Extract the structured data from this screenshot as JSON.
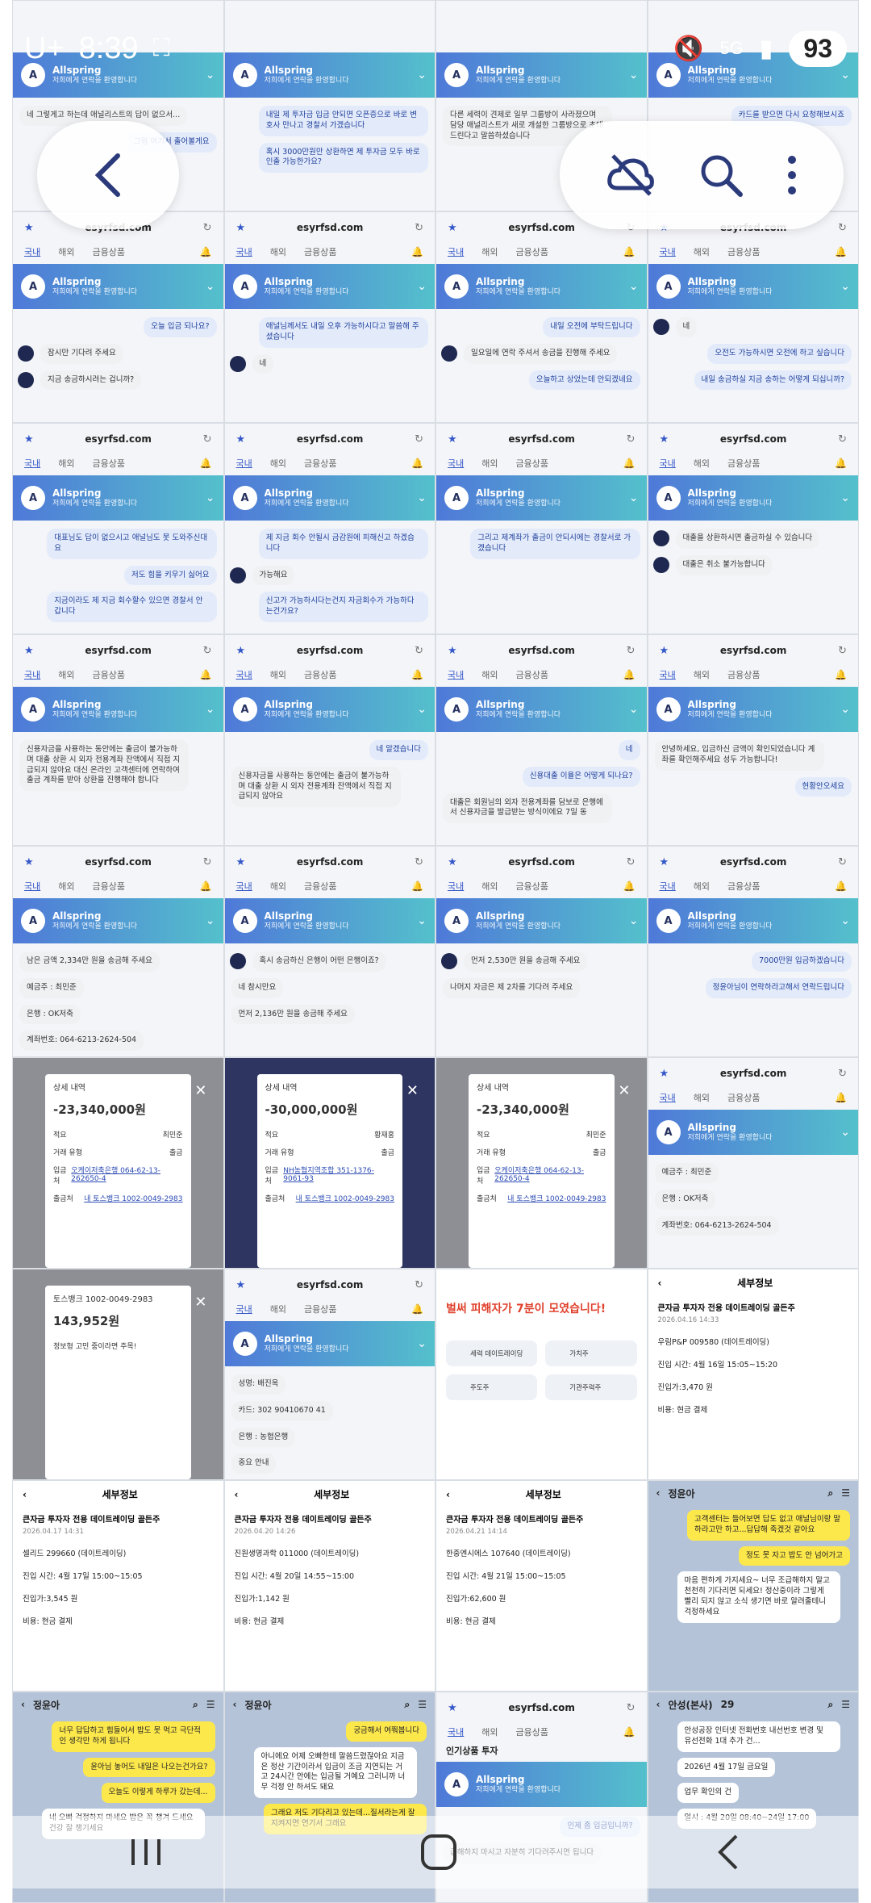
{
  "status_bar": {
    "time": "8:39",
    "network": "5G",
    "battery": "93",
    "carrier": "U+"
  },
  "site": {
    "url": "esyrfsd.com",
    "tabs": [
      "국내",
      "해외",
      "금융상품"
    ]
  },
  "banner": {
    "name": "Allspring",
    "subtitle": "저희에게 연락을 환영합니다"
  },
  "tiles": {
    "t1": [
      "네 그렇게고 하는데 애널리스트의 답이 없으서...",
      "그럼 여기서 출어볼게요"
    ],
    "t2": [
      "내일 제 투자금 입금 안되면 오픈증으로 바로 변호사 만나고 경찰서 가겠습니다",
      "혹시 3000만원만 상환하면 제 투자금 모두 바로 인출 가능한가요?"
    ],
    "t3": [
      "다른 세력이 견제로 일부 그룹방이 사라졌으며 담당 애널리스트가 새로 개설한 그룹방으로 초대드린다고 말씀하셨습니다"
    ],
    "t4": [
      "카드를 받으면 다시 요청해보시죠"
    ],
    "t5": [
      "오늘 입금 되나요?",
      "잠시만 기다려 주세요",
      "지금 송금하시려는 겁니까?"
    ],
    "t6": [
      "애널님께서도 내일 오후 가능하시다고 말씀해 주셨습니다",
      "네"
    ],
    "t7": [
      "내일 오전에 부탁드립니다",
      "일요일에 연락 주셔서 송금을 진행해 주세요",
      "오늘하고 상었는데 안되겠네요"
    ],
    "t8": [
      "네",
      "오전도 가능하시면 오전에 하고 싶습니다",
      "내일 송금하실 지금 송하는 어떻게 되십니까?"
    ],
    "t9": [
      "대표님도 답이 없으시고 애널님도 못 도와주신대요",
      "저도 힘을 키우기 싫어요",
      "지금이라도 제 지금 회수할수 있으면 경찰서 안 갑니다"
    ],
    "t10": [
      "제 지금 회수 안될시 금감원에 피해신고 하겠습니다",
      "가능해요",
      "신고가 가능하시다는건지 자금회수가 가능하다는건가요?"
    ],
    "t11": [
      "그리고 제계좌가 출금이 안되시에는 경찰서로 가겠습니다"
    ],
    "t12": [
      "대출을 상환하시면 출금하실 수 있습니다",
      "대출은 취소 불가능합니다"
    ],
    "t13": [
      "신용자금을 사용하는 동안에는 출금이 불가능하며 대출 상환 시 외자 전용계좌 잔액에서 직접 지급되지 않아요 대신 온라인 고객센터에 연락하여 출금 계좌를 받아 상환을 진행해야 합니다"
    ],
    "t14": [
      "네 알겠습니다",
      "신용자금을 사용하는 동안에는 출금이 불가능하며 대출 상환 시 외자 전용계좌 잔액에서 직접 지급되지 않아요"
    ],
    "t15": [
      "네",
      "신용대출 이율은 어떻게 되나요?",
      "대출은 회원님의 외자 전용계좌를 담보로 은행에서 신용자금을 발급받는 방식이에요 7일 동"
    ],
    "t16": [
      "안녕하세요, 입금하신 금액이 확인되었습니다 계좌를 확인해주세요 성두 가능합니다!",
      "현황안오세요"
    ],
    "t17": [
      "남은 금액 2,334만 원을 송금해 주세요",
      "예금주 : 최민준",
      "은행 : OK저축",
      "계좌번호: 064-6213-2624-504"
    ],
    "t18": [
      "혹시 송금하신 은행이 어떤 은행이죠?",
      "네 참시만요",
      "먼저 2,136만 원을 송금해 주세요"
    ],
    "t19": [
      "먼저 2,530만 원을 송금해 주세요",
      "나머지 자금은 제 2차를 기다려 주세요"
    ],
    "t20": [
      "7000만원 입금하겠습니다",
      "정윤아님이 연락하라고해서 연락드립니다"
    ],
    "t21": {
      "hd": "상세 내역",
      "amt": "-23,340,000원",
      "rows": [
        [
          "적요",
          "최민준"
        ],
        [
          "거래 유형",
          "출금"
        ],
        [
          "입금처",
          "오케이저축은행 064-62-13-262650-4"
        ],
        [
          "출금처",
          "내 토스뱅크 1002-0049-2983"
        ]
      ]
    },
    "t22": {
      "hd": "상세 내역",
      "amt": "-30,000,000원",
      "rows": [
        [
          "적요",
          "황재홍"
        ],
        [
          "거래 유형",
          "출금"
        ],
        [
          "입금처",
          "NH농협지역조합 351-1376-9061-93"
        ],
        [
          "출금처",
          "내 토스뱅크 1002-0049-2983"
        ]
      ]
    },
    "t23": {
      "hd": "상세 내역",
      "amt": "-23,340,000원",
      "rows": [
        [
          "적요",
          "최민준"
        ],
        [
          "거래 유형",
          "출금"
        ],
        [
          "입금처",
          "오케이저축은행 064-62-13-262650-4"
        ],
        [
          "출금처",
          "내 토스뱅크 1002-0049-2983"
        ]
      ]
    },
    "t24": [
      "예금주 : 최민준",
      "은행 : OK저축",
      "계좌번호: 064-6213-2624-504"
    ],
    "t25": {
      "acct": "토스뱅크 1002-0049-2983",
      "amt": "143,952원",
      "item": "정보형 고민 중이라면 주목!"
    },
    "t26": [
      "성명: 배진옥",
      "카드: 302 90410670 41",
      "은행 : 농협은행",
      "중요 안내"
    ],
    "t27": {
      "warning": "벌써 피해자가 7분이 모였습니다!",
      "items": [
        "세력 데이트레이딩",
        "가치주",
        "주도주",
        "기관주력주"
      ]
    },
    "t28": {
      "title": "큰자금 투자자 전용 데이트레이딩 골든주",
      "date": "2026.04.16 14:33",
      "stock": "우림P&P 009580 (데이트레이딩)",
      "time": "진입 시간: 4월 16일 15:05~15:20",
      "price": "진입가:3,470 원",
      "cost": "비용: 현금 결제"
    },
    "t29": {
      "title": "큰자금 투자자 전용 데이트레이딩 골든주",
      "date": "2026.04.17 14:31",
      "stock": "셀리드 299660 (데이트레이딩)",
      "time": "진입 시간: 4월 17일 15:00~15:05",
      "price": "진입가:3,545 원",
      "cost": "비용: 현금 결제"
    },
    "t30": {
      "title": "큰자금 투자자 전용 데이트레이딩 골든주",
      "date": "2026.04.20 14:26",
      "stock": "진원생명과학 011000 (데이트레이딩)",
      "time": "진입 시간: 4월 20일 14:55~15:00",
      "price": "진입가:1,142 원",
      "cost": "비용: 현금 결제"
    },
    "t31": {
      "title": "큰자금 투자자 전용 데이트레이딩 골든주",
      "date": "2026.04.21 14:14",
      "stock": "한중엔시에스 107640 (데이트레이딩)",
      "time": "진입 시간: 4월 21일 15:00~15:05",
      "price": "진입가:62,600 원",
      "cost": "비용: 현금 결제"
    },
    "t32": {
      "name": "정윤아",
      "msgs": [
        "고객센터는 들어보면 답도 없고 애널님이랑 말하라고만 하고...답답해 죽겠것 같아요",
        "정도 못 자고 밥도 안 넘어가고",
        "마음 편하게 가지세요~ 너무 조급해하지 말고 천천히 기다리면 되세요! 정산중이라 그렇게 빨리 되지 않고 소식 생기면 바로 알려줄테니 걱정하세요"
      ]
    },
    "t33": {
      "name": "정윤아",
      "msgs": [
        "너무 답답하고 힘들어서 밥도 못 먹고 극단적인 생각만 하게 됩니다",
        "윤아님 놓어도 내일은 나오는건가요?",
        "오늘도 이렇게 하루가 갔는데...",
        "네 오빠 걱정하지 마세요 밥은 꼭 챙겨 드세요 건강 잘 챙기세요"
      ]
    },
    "t34": {
      "name": "정윤아",
      "msgs": [
        "궁금해서 여쭤봅니다",
        "아니에요 어제 오빠한테 말씀드렸잖아요 지금은 정산 기간이라서 입금이 조금 지연되는 거고 24시간 안에는 입금될 거예요 그러니까 너무 걱정 안 하셔도 돼요",
        "그래요 저도 기다리고 있는데...질서라는게 잘 지켜지면 연기서 그래요"
      ]
    },
    "t35": {
      "hot": "인기상품 투자",
      "msgs": [
        "인제 좀 입금입니까?",
        "급해하지 마시고 자분히 기다려주시면 됩니다"
      ]
    },
    "t36": {
      "name": "안성(본사)",
      "count": "29",
      "notice": "안성공장 인터넷 전화번호 내선번호 변경 및 유선전화 1대 추가 건...",
      "date": "2026년 4월 17일 금요일",
      "msgs": [
        "업무 확인의 건",
        "일시 : 4월 20일 08:40~24일 17:00"
      ]
    }
  },
  "overlay": {
    "back_icon": "chevron-left-icon",
    "icons": [
      "cloud-off-icon",
      "search-icon",
      "more-vert-icon"
    ]
  },
  "nav": {
    "icons": [
      "recent-apps-icon",
      "home-icon",
      "back-icon"
    ]
  }
}
